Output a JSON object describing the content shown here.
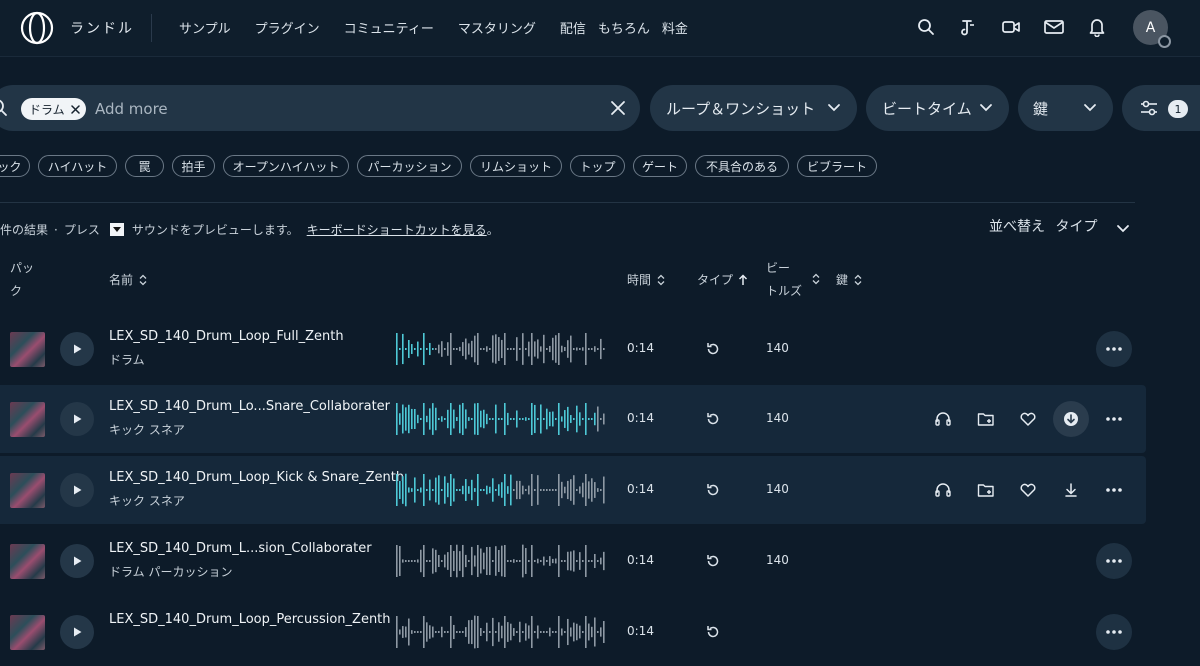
{
  "header": {
    "brand": "ランドル",
    "nav": [
      "サンプル",
      "プラグイン",
      "コミュニティー",
      "マスタリング",
      "配信",
      "もちろん",
      "料金"
    ],
    "avatar_initial": "A",
    "icons": [
      "search-icon",
      "music-note-icon",
      "video-icon",
      "mail-icon",
      "bell-icon"
    ]
  },
  "search": {
    "chip_label": "ドラム",
    "placeholder": "Add more"
  },
  "filters": {
    "type": "ループ＆ワンショット",
    "bpm": "ビートタイム",
    "key": "鍵",
    "count": "1"
  },
  "tags": [
    "ック",
    "ハイハット",
    "罠",
    "拍手",
    "オープンハイハット",
    "パーカッション",
    "リムショット",
    "トップ",
    "ゲート",
    "不具合のある",
    "ビブラート"
  ],
  "results": {
    "prefix": "件の結果",
    "dot": "·",
    "press": "プレス",
    "preview_text": "サウンドをプレビューします。",
    "shortcut_link": "キーボードショートカットを見る",
    "period": "。",
    "sort_label": "並べ替え",
    "sort_value": "タイプ"
  },
  "columns": {
    "pack_line1": "パッ",
    "pack_line2": "ク",
    "name": "名前",
    "time": "時間",
    "type": "タイプ",
    "bpm_line1": "ビー",
    "bpm_line2": "トルズ",
    "key": "鍵"
  },
  "rows": [
    {
      "name": "LEX_SD_140_Drum_Loop_Full_Zenth",
      "tags": "ドラム",
      "time": "0:14",
      "bpm": "140",
      "highlighted": false
    },
    {
      "name": "LEX_SD_140_Drum_Lo...Snare_Collaborater",
      "tags": "キック  スネア",
      "time": "0:14",
      "bpm": "140",
      "highlighted": true
    },
    {
      "name": "LEX_SD_140_Drum_Loop_Kick & Snare_Zenth",
      "tags": "キック  スネア",
      "time": "0:14",
      "bpm": "140",
      "highlighted": true
    },
    {
      "name": "LEX_SD_140_Drum_L...sion_Collaborater",
      "tags": "ドラム  パーカッション",
      "time": "0:14",
      "bpm": "140",
      "highlighted": false
    },
    {
      "name": "LEX_SD_140_Drum_Loop_Percussion_Zenth",
      "tags": "",
      "time": "0:14",
      "bpm": "",
      "highlighted": false
    }
  ],
  "colors": {
    "background": "#0d1b29",
    "accent_wave": "#4ec9d6",
    "muted_wave": "#8e99a4"
  }
}
